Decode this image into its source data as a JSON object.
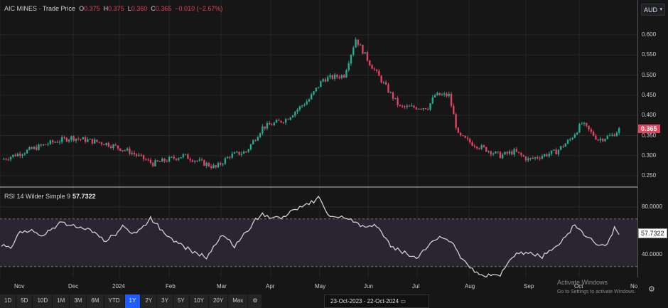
{
  "header": {
    "symbol": "AIC MINES",
    "sep": "·",
    "type": "Trade Price",
    "o_label": "O",
    "o": "0.375",
    "h_label": "H",
    "h": "0.375",
    "l_label": "L",
    "l": "0.360",
    "c_label": "C",
    "c": "0.365",
    "change": "−0.010 (−2.67%)"
  },
  "currency": "AUD",
  "price_ticks": [
    "0.600",
    "0.550",
    "0.500",
    "0.450",
    "0.400",
    "0.350",
    "0.300",
    "0.250"
  ],
  "last_price": "0.365",
  "rsi": {
    "label": "RSI 14 Wilder Simple 9",
    "value": "57.7322",
    "ticks": [
      "80.0000",
      "40.0000"
    ]
  },
  "months": [
    "Nov",
    "Dec",
    "2024",
    "Feb",
    "Mar",
    "Apr",
    "May",
    "Jun",
    "Jul",
    "Aug",
    "Sep",
    "Oct",
    "No"
  ],
  "ranges": [
    "1D",
    "5D",
    "10D",
    "1M",
    "3M",
    "6M",
    "YTD",
    "1Y",
    "2Y",
    "3Y",
    "5Y",
    "10Y",
    "20Y",
    "Max"
  ],
  "active_range": "1Y",
  "date_range": {
    "from": "23-Oct-2023",
    "sep": "-",
    "to": "22-Oct-2024"
  },
  "watermark": {
    "title": "Activate Windows",
    "sub": "Go to Settings to activate Windows."
  },
  "colors": {
    "up": "#22ab94",
    "down": "#e2435d",
    "rsi_band": "#2a2433",
    "accent": "#1f5cff"
  },
  "price_path": [
    [
      0,
      0.29
    ],
    [
      20,
      0.33
    ],
    [
      30,
      0.345
    ],
    [
      45,
      0.33
    ],
    [
      55,
      0.31
    ],
    [
      65,
      0.28
    ],
    [
      78,
      0.3
    ],
    [
      92,
      0.27
    ],
    [
      98,
      0.3
    ],
    [
      105,
      0.31
    ],
    [
      112,
      0.37
    ],
    [
      122,
      0.39
    ],
    [
      132,
      0.44
    ],
    [
      138,
      0.49
    ],
    [
      147,
      0.5
    ],
    [
      152,
      0.59
    ],
    [
      158,
      0.53
    ],
    [
      165,
      0.47
    ],
    [
      171,
      0.42
    ],
    [
      183,
      0.42
    ],
    [
      186,
      0.45
    ],
    [
      192,
      0.45
    ],
    [
      196,
      0.35
    ],
    [
      202,
      0.33
    ],
    [
      214,
      0.3
    ],
    [
      220,
      0.31
    ],
    [
      226,
      0.29
    ],
    [
      238,
      0.31
    ],
    [
      244,
      0.34
    ],
    [
      249,
      0.38
    ],
    [
      256,
      0.34
    ],
    [
      262,
      0.35
    ],
    [
      265,
      0.365
    ]
  ],
  "rsi_path": [
    [
      0,
      47
    ],
    [
      4,
      47
    ],
    [
      8,
      58
    ],
    [
      13,
      60
    ],
    [
      18,
      56
    ],
    [
      26,
      68
    ],
    [
      32,
      63
    ],
    [
      38,
      60
    ],
    [
      45,
      51
    ],
    [
      52,
      63
    ],
    [
      58,
      58
    ],
    [
      64,
      70
    ],
    [
      72,
      55
    ],
    [
      80,
      45
    ],
    [
      88,
      37
    ],
    [
      95,
      57
    ],
    [
      100,
      46
    ],
    [
      108,
      67
    ],
    [
      112,
      74
    ],
    [
      120,
      70
    ],
    [
      126,
      78
    ],
    [
      132,
      82
    ],
    [
      136,
      88
    ],
    [
      141,
      72
    ],
    [
      150,
      70
    ],
    [
      157,
      62
    ],
    [
      161,
      65
    ],
    [
      167,
      48
    ],
    [
      172,
      42
    ],
    [
      178,
      38
    ],
    [
      186,
      52
    ],
    [
      190,
      55
    ],
    [
      195,
      45
    ],
    [
      200,
      30
    ],
    [
      207,
      22
    ],
    [
      214,
      23
    ],
    [
      220,
      40
    ],
    [
      225,
      42
    ],
    [
      232,
      38
    ],
    [
      240,
      50
    ],
    [
      246,
      65
    ],
    [
      250,
      58
    ],
    [
      256,
      47
    ],
    [
      260,
      50
    ],
    [
      263,
      62
    ],
    [
      265,
      57.7
    ]
  ]
}
